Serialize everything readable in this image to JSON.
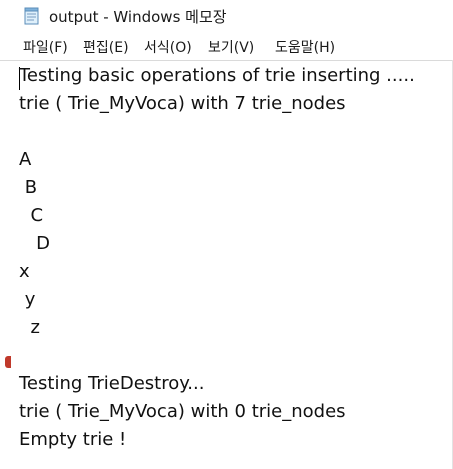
{
  "window": {
    "title": "output - Windows 메모장",
    "app_icon": "notepad-icon"
  },
  "menu": {
    "items": [
      {
        "label": "파일(F)"
      },
      {
        "label": "편집(E)"
      },
      {
        "label": "서식(O)"
      },
      {
        "label": "보기(V)"
      },
      {
        "label": "도움말(H)"
      }
    ]
  },
  "document": {
    "lines": [
      "Testing basic operations of trie inserting .....",
      "trie ( Trie_MyVoca) with 7 trie_nodes",
      "",
      "A",
      " B",
      "  C",
      "   D",
      "x",
      " y",
      "  z",
      "",
      "Testing TrieDestroy...",
      "trie ( Trie_MyVoca) with 0 trie_nodes",
      "Empty trie !"
    ]
  },
  "colors": {
    "text": "#111111",
    "background": "#ffffff",
    "margin_marker": "#c0392b"
  }
}
